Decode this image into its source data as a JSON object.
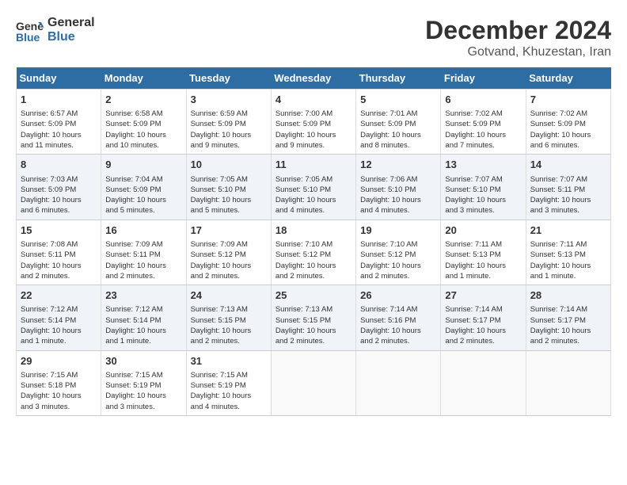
{
  "header": {
    "logo_line1": "General",
    "logo_line2": "Blue",
    "month": "December 2024",
    "location": "Gotvand, Khuzestan, Iran"
  },
  "weekdays": [
    "Sunday",
    "Monday",
    "Tuesday",
    "Wednesday",
    "Thursday",
    "Friday",
    "Saturday"
  ],
  "weeks": [
    [
      {
        "day": "1",
        "info": "Sunrise: 6:57 AM\nSunset: 5:09 PM\nDaylight: 10 hours\nand 11 minutes."
      },
      {
        "day": "2",
        "info": "Sunrise: 6:58 AM\nSunset: 5:09 PM\nDaylight: 10 hours\nand 10 minutes."
      },
      {
        "day": "3",
        "info": "Sunrise: 6:59 AM\nSunset: 5:09 PM\nDaylight: 10 hours\nand 9 minutes."
      },
      {
        "day": "4",
        "info": "Sunrise: 7:00 AM\nSunset: 5:09 PM\nDaylight: 10 hours\nand 9 minutes."
      },
      {
        "day": "5",
        "info": "Sunrise: 7:01 AM\nSunset: 5:09 PM\nDaylight: 10 hours\nand 8 minutes."
      },
      {
        "day": "6",
        "info": "Sunrise: 7:02 AM\nSunset: 5:09 PM\nDaylight: 10 hours\nand 7 minutes."
      },
      {
        "day": "7",
        "info": "Sunrise: 7:02 AM\nSunset: 5:09 PM\nDaylight: 10 hours\nand 6 minutes."
      }
    ],
    [
      {
        "day": "8",
        "info": "Sunrise: 7:03 AM\nSunset: 5:09 PM\nDaylight: 10 hours\nand 6 minutes."
      },
      {
        "day": "9",
        "info": "Sunrise: 7:04 AM\nSunset: 5:09 PM\nDaylight: 10 hours\nand 5 minutes."
      },
      {
        "day": "10",
        "info": "Sunrise: 7:05 AM\nSunset: 5:10 PM\nDaylight: 10 hours\nand 5 minutes."
      },
      {
        "day": "11",
        "info": "Sunrise: 7:05 AM\nSunset: 5:10 PM\nDaylight: 10 hours\nand 4 minutes."
      },
      {
        "day": "12",
        "info": "Sunrise: 7:06 AM\nSunset: 5:10 PM\nDaylight: 10 hours\nand 4 minutes."
      },
      {
        "day": "13",
        "info": "Sunrise: 7:07 AM\nSunset: 5:10 PM\nDaylight: 10 hours\nand 3 minutes."
      },
      {
        "day": "14",
        "info": "Sunrise: 7:07 AM\nSunset: 5:11 PM\nDaylight: 10 hours\nand 3 minutes."
      }
    ],
    [
      {
        "day": "15",
        "info": "Sunrise: 7:08 AM\nSunset: 5:11 PM\nDaylight: 10 hours\nand 2 minutes."
      },
      {
        "day": "16",
        "info": "Sunrise: 7:09 AM\nSunset: 5:11 PM\nDaylight: 10 hours\nand 2 minutes."
      },
      {
        "day": "17",
        "info": "Sunrise: 7:09 AM\nSunset: 5:12 PM\nDaylight: 10 hours\nand 2 minutes."
      },
      {
        "day": "18",
        "info": "Sunrise: 7:10 AM\nSunset: 5:12 PM\nDaylight: 10 hours\nand 2 minutes."
      },
      {
        "day": "19",
        "info": "Sunrise: 7:10 AM\nSunset: 5:12 PM\nDaylight: 10 hours\nand 2 minutes."
      },
      {
        "day": "20",
        "info": "Sunrise: 7:11 AM\nSunset: 5:13 PM\nDaylight: 10 hours\nand 1 minute."
      },
      {
        "day": "21",
        "info": "Sunrise: 7:11 AM\nSunset: 5:13 PM\nDaylight: 10 hours\nand 1 minute."
      }
    ],
    [
      {
        "day": "22",
        "info": "Sunrise: 7:12 AM\nSunset: 5:14 PM\nDaylight: 10 hours\nand 1 minute."
      },
      {
        "day": "23",
        "info": "Sunrise: 7:12 AM\nSunset: 5:14 PM\nDaylight: 10 hours\nand 1 minute."
      },
      {
        "day": "24",
        "info": "Sunrise: 7:13 AM\nSunset: 5:15 PM\nDaylight: 10 hours\nand 2 minutes."
      },
      {
        "day": "25",
        "info": "Sunrise: 7:13 AM\nSunset: 5:15 PM\nDaylight: 10 hours\nand 2 minutes."
      },
      {
        "day": "26",
        "info": "Sunrise: 7:14 AM\nSunset: 5:16 PM\nDaylight: 10 hours\nand 2 minutes."
      },
      {
        "day": "27",
        "info": "Sunrise: 7:14 AM\nSunset: 5:17 PM\nDaylight: 10 hours\nand 2 minutes."
      },
      {
        "day": "28",
        "info": "Sunrise: 7:14 AM\nSunset: 5:17 PM\nDaylight: 10 hours\nand 2 minutes."
      }
    ],
    [
      {
        "day": "29",
        "info": "Sunrise: 7:15 AM\nSunset: 5:18 PM\nDaylight: 10 hours\nand 3 minutes."
      },
      {
        "day": "30",
        "info": "Sunrise: 7:15 AM\nSunset: 5:19 PM\nDaylight: 10 hours\nand 3 minutes."
      },
      {
        "day": "31",
        "info": "Sunrise: 7:15 AM\nSunset: 5:19 PM\nDaylight: 10 hours\nand 4 minutes."
      },
      null,
      null,
      null,
      null
    ]
  ]
}
